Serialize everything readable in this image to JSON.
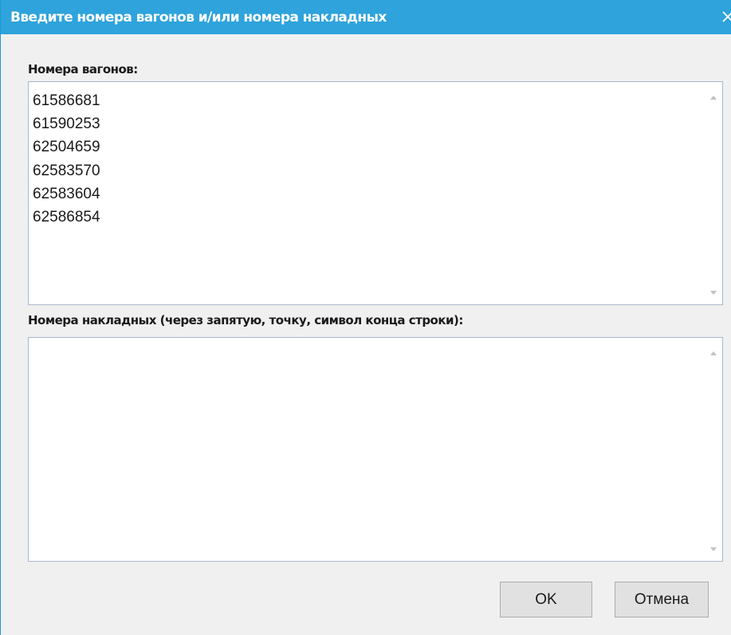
{
  "window": {
    "title": "Введите номера вагонов и/или номера накладных",
    "close_icon": "close-icon"
  },
  "wagons": {
    "label": "Номера вагонов:",
    "lines": [
      "61586681",
      "61590253",
      "62504659",
      "62583570",
      "62583604",
      "62586854"
    ]
  },
  "invoices": {
    "label": "Номера накладных (через запятую, точку, символ конца строки):",
    "value": ""
  },
  "buttons": {
    "ok_label": "OK",
    "cancel_label": "Отмена"
  },
  "colors": {
    "titlebar": "#2ea3dc",
    "window_bg": "#f0f0f0",
    "textbox_border": "#a9b8cc",
    "button_bg": "#e1e1e1"
  }
}
